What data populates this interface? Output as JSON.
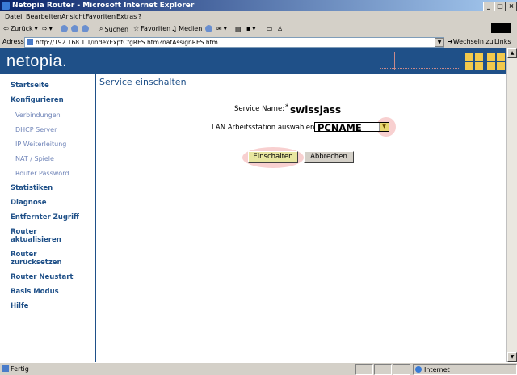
{
  "window": {
    "title": "Netopia Router - Microsoft Internet Explorer",
    "min_label": "_",
    "max_label": "□",
    "close_label": "×"
  },
  "menu": {
    "items": [
      "Datei",
      "Bearbeiten",
      "Ansicht",
      "Favoriten",
      "Extras",
      "?"
    ]
  },
  "toolbar": {
    "back_label": "Zurück",
    "search_label": "Suchen",
    "favorites_label": "Favoriten",
    "media_label": "Medien"
  },
  "address": {
    "label": "Adresse",
    "url": "http://192.168.1.1/indexExptCfgRES.htm?natAssignRES.htm",
    "go_label": "Wechseln zu",
    "links_label": "Links"
  },
  "header": {
    "logo": "netopia."
  },
  "sidebar": {
    "items": [
      {
        "label": "Startseite",
        "type": "main"
      },
      {
        "label": "Konfigurieren",
        "type": "main"
      },
      {
        "label": "Verbindungen",
        "type": "sub"
      },
      {
        "label": "DHCP Server",
        "type": "sub"
      },
      {
        "label": "IP Weiterleitung",
        "type": "sub"
      },
      {
        "label": "NAT / Spiele",
        "type": "sub"
      },
      {
        "label": "Router Password",
        "type": "sub"
      },
      {
        "label": "Statistiken",
        "type": "main"
      },
      {
        "label": "Diagnose",
        "type": "main"
      },
      {
        "label": "Entfernter Zugriff",
        "type": "main"
      },
      {
        "label": "Router",
        "label2": "aktualisieren",
        "type": "main"
      },
      {
        "label": "Router",
        "label2": "zurücksetzen",
        "type": "main"
      },
      {
        "label": "Router Neustart",
        "type": "main"
      },
      {
        "label": "Basis Modus",
        "type": "main"
      },
      {
        "label": "Hilfe",
        "type": "main"
      }
    ]
  },
  "main": {
    "title": "Service einschalten",
    "service_label": "Service Name:",
    "service_marker": "*",
    "service_value": "swissjass",
    "lan_label": "LAN Arbeitsstation auswählen",
    "lan_value": "PCNAME",
    "enable_button": "Einschalten",
    "cancel_button": "Abbrechen"
  },
  "status": {
    "text": "Fertig",
    "zone": "Internet"
  },
  "colors": {
    "brand": "#1f5088",
    "nav_sub": "#6f84b8",
    "accent_yellow": "#f2c94c",
    "highlight": "#f09696"
  }
}
